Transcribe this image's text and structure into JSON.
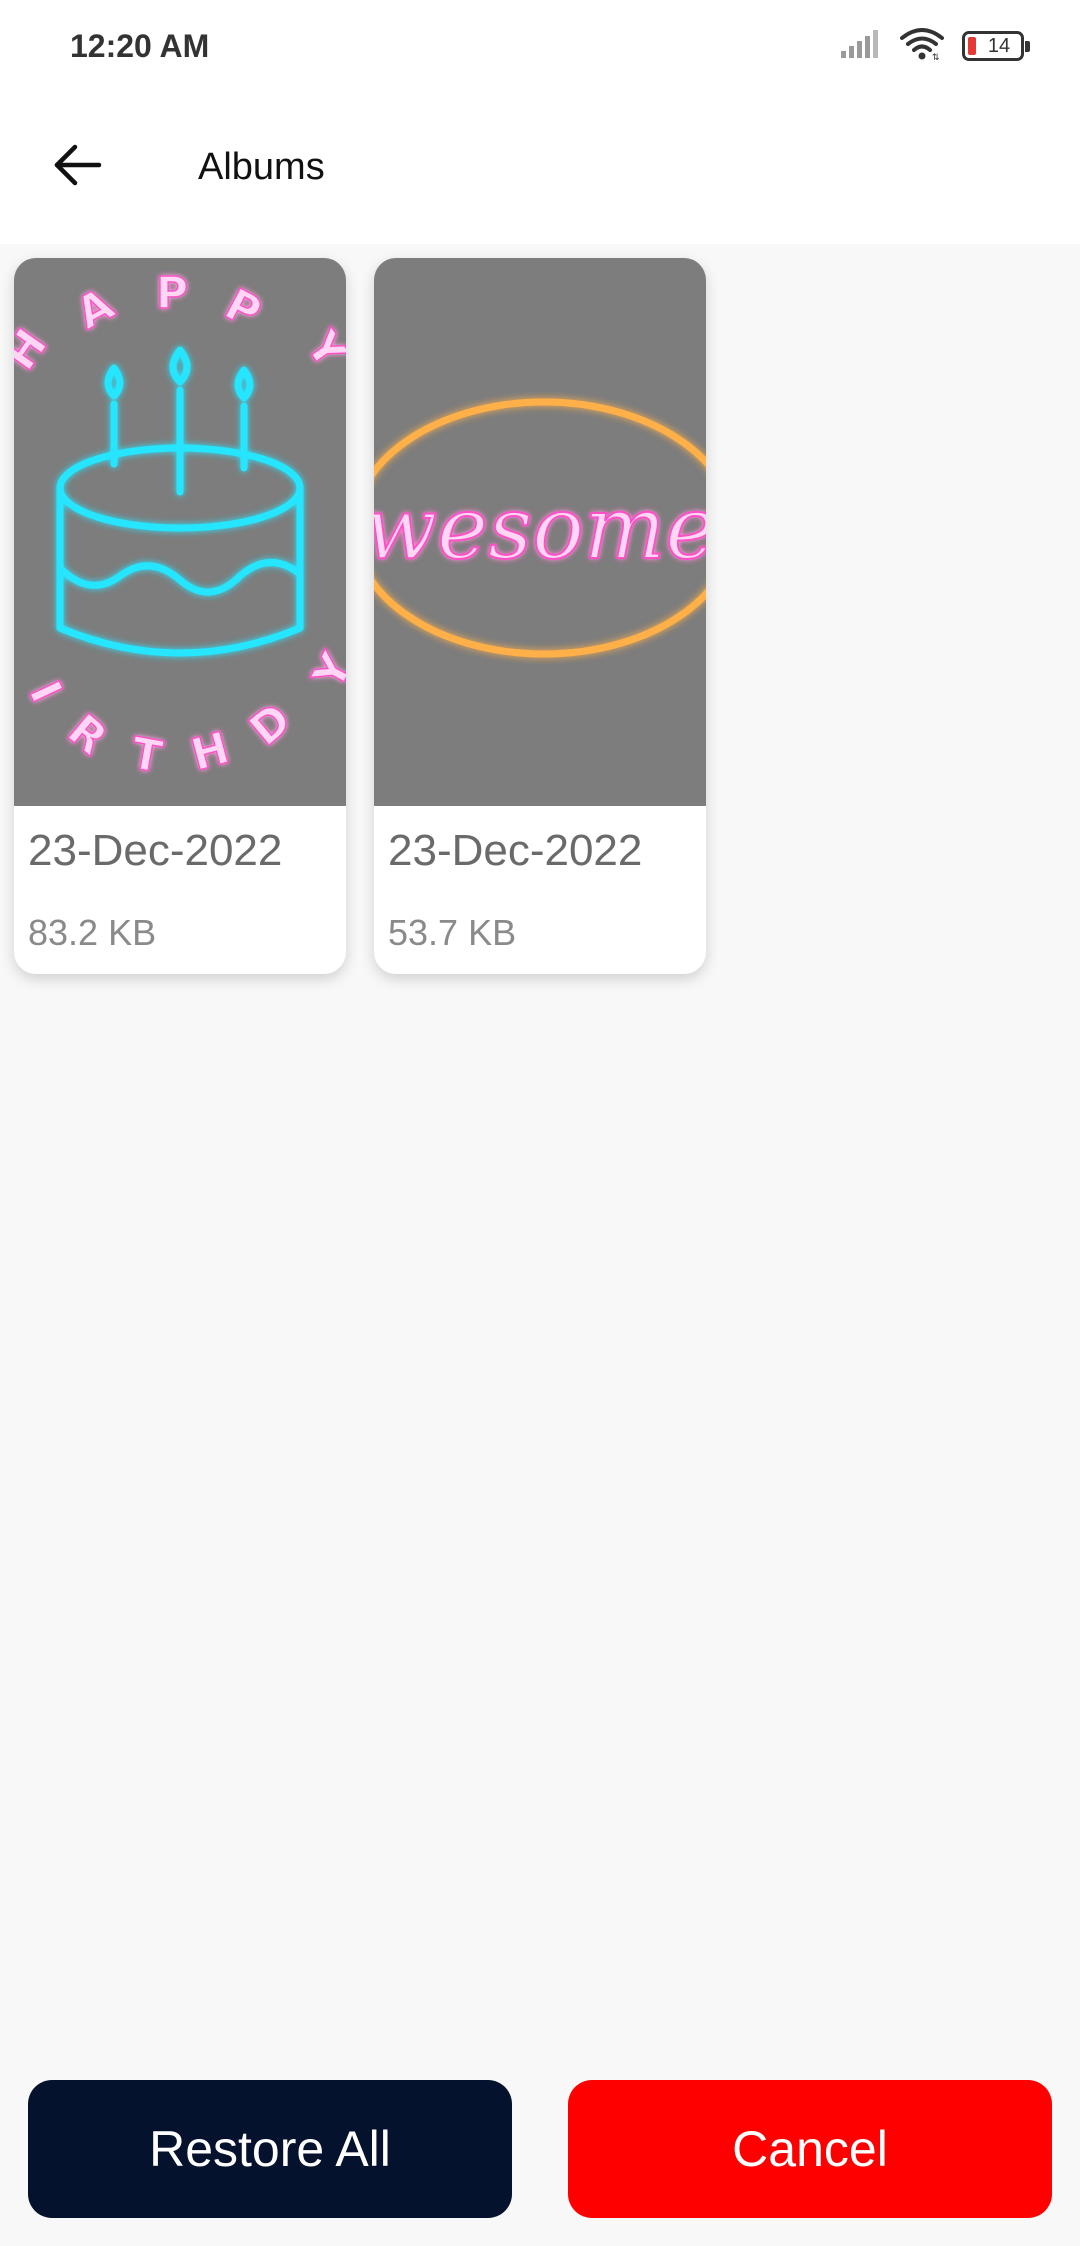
{
  "status_bar": {
    "time": "12:20 AM",
    "battery_level": "14",
    "icons": [
      "signal-icon",
      "wifi-icon",
      "battery-icon"
    ]
  },
  "app_bar": {
    "back_icon": "arrow-left-icon",
    "title": "Albums"
  },
  "albums": [
    {
      "thumbnail": "happy-birthday-neon-cake",
      "thumbnail_text": "HAPPY BIRTHDAY",
      "date": "23-Dec-2022",
      "size": "83.2 KB"
    },
    {
      "thumbnail": "awesome-neon-oval",
      "thumbnail_text": "wesome",
      "date": "23-Dec-2022",
      "size": "53.7 KB"
    }
  ],
  "actions": {
    "restore_label": "Restore All",
    "cancel_label": "Cancel"
  },
  "colors": {
    "restore_button": "#04122d",
    "cancel_button": "#fe0000",
    "neon_pink": "#ff4fc8",
    "neon_cyan": "#27e6ff",
    "neon_orange": "#ff9a2e",
    "thumb_background": "#7d7d7d"
  }
}
